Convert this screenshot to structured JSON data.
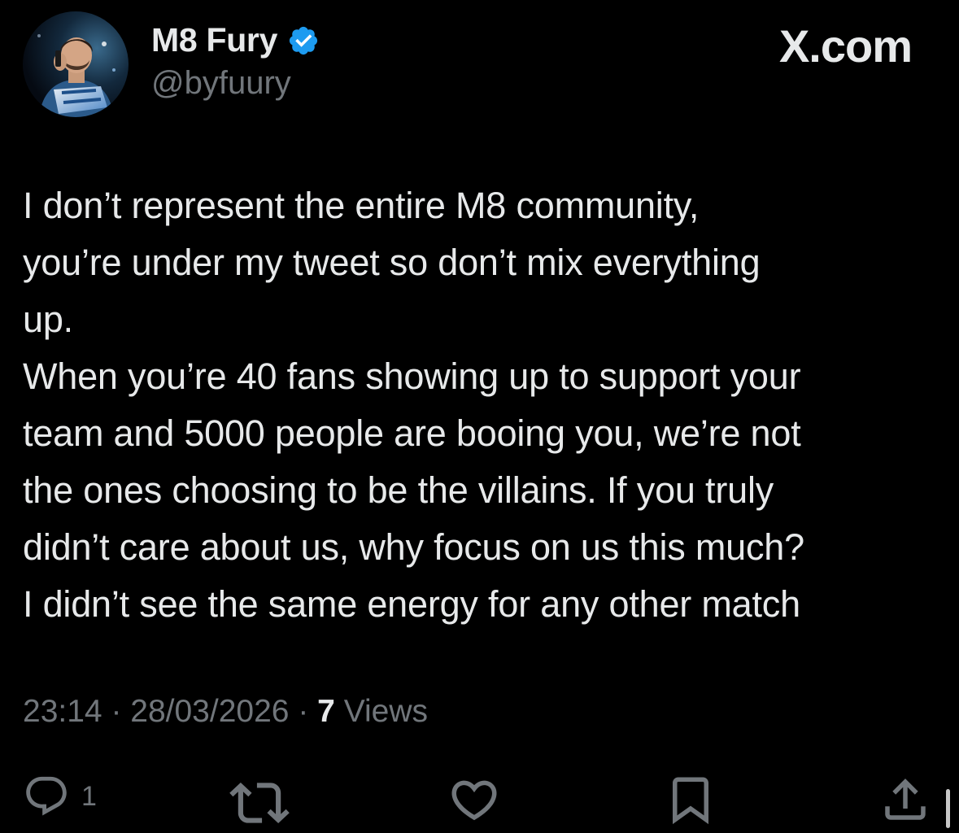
{
  "author": {
    "display_name": "M8 Fury",
    "handle": "@byfuury",
    "verified": true,
    "avatar_icon": "user-avatar"
  },
  "brand": {
    "label": "X.com"
  },
  "tweet": {
    "text": "I don’t represent the entire M8 community,\nyou’re under my tweet so don’t mix everything\nup.\nWhen you’re 40 fans showing up to support your\nteam and 5000 people are booing you, we’re not\nthe ones choosing to be the villains. If you truly\ndidn’t care about us, why focus on us this much?\nI didn’t see the same energy for any other match"
  },
  "meta": {
    "time": "23:14",
    "separator": " · ",
    "date": "28/03/2026",
    "views_count": "7",
    "views_label": " Views"
  },
  "actions": {
    "reply_count": "1",
    "icons": [
      "reply-icon",
      "retweet-icon",
      "like-icon",
      "bookmark-icon",
      "share-icon"
    ]
  },
  "colors": {
    "background": "#000000",
    "text_primary": "#e7e9ea",
    "text_secondary": "#71767b",
    "verified_blue": "#1d9bf0"
  }
}
